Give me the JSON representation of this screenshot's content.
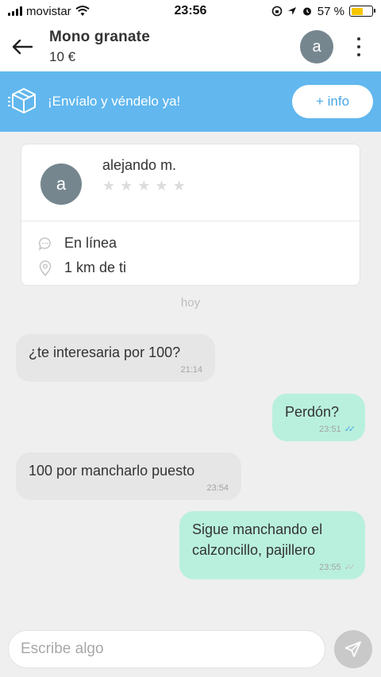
{
  "status_bar": {
    "carrier": "movistar",
    "time": "23:56",
    "battery_percent": "57 %",
    "battery_level": 0.57,
    "icons": [
      "signal-icon",
      "wifi-icon",
      "screen-lock-icon",
      "location-icon",
      "alarm-icon",
      "battery-icon"
    ]
  },
  "header": {
    "title": "Mono granate",
    "price": "10 €",
    "avatar_letter": "a",
    "icons": [
      "back-arrow-icon",
      "more-vertical-icon"
    ]
  },
  "promo": {
    "text": "¡Envíalo y véndelo ya!",
    "button_label": "+ info",
    "icon": "shipping-box-icon",
    "background": "#61b7ee"
  },
  "profile": {
    "avatar_letter": "a",
    "name": "alejando m.",
    "rating_stars": 0,
    "rating_max": 5,
    "status": "En línea",
    "distance": "1 km de ti"
  },
  "day_separator": "hoy",
  "messages": [
    {
      "direction": "incoming",
      "text": "¿te interesaria por 100?",
      "time": "21:14"
    },
    {
      "direction": "outgoing",
      "text": "Perdón?",
      "time": "23:51",
      "status": "read"
    },
    {
      "direction": "incoming",
      "text": "100 por mancharlo puesto",
      "time": "23:54"
    },
    {
      "direction": "outgoing",
      "text": "Sigue manchando el calzoncillo, pajillero",
      "time": "23:55",
      "status": "delivered"
    }
  ],
  "composer": {
    "placeholder": "Escribe algo",
    "send_icon": "send-icon"
  },
  "colors": {
    "incoming_bubble": "#e6e6e6",
    "outgoing_bubble": "#b9f0dd",
    "avatar": "#75868f",
    "read_check": "#4aa8e4"
  }
}
